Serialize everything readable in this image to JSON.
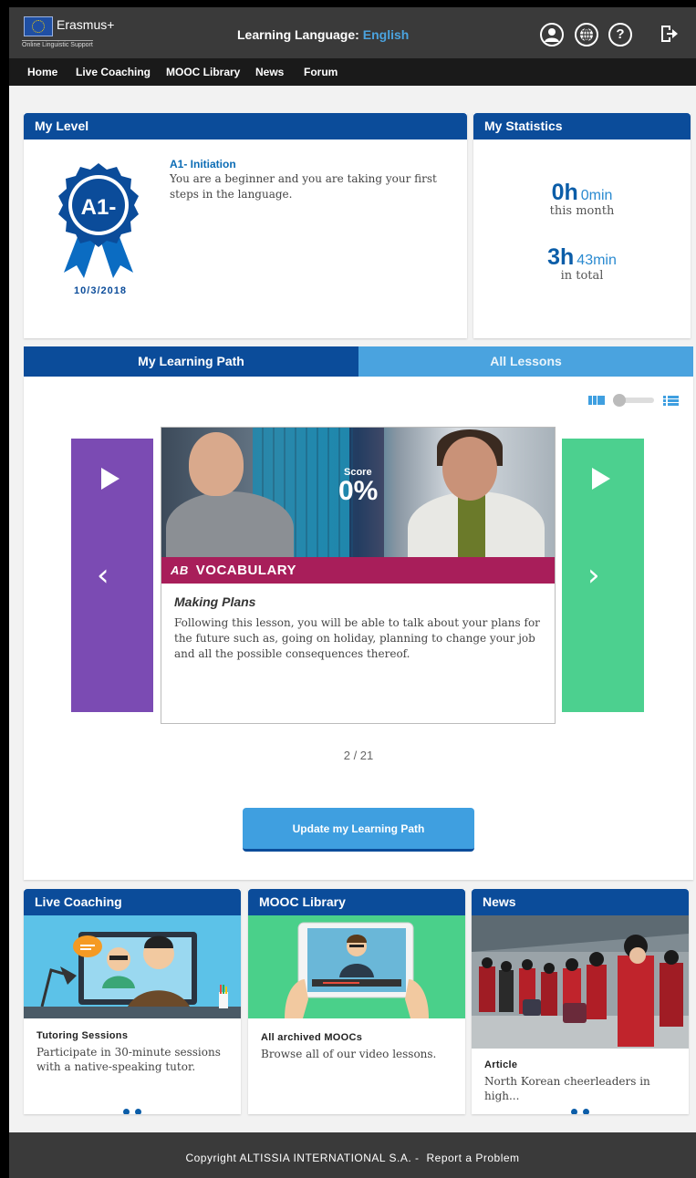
{
  "header": {
    "brand": "Erasmus+",
    "brand_sub": "Online Linguistic Support",
    "learning_language_label": "Learning Language:",
    "learning_language_value": "English",
    "icons": [
      "user-icon",
      "globe-icon",
      "help-icon",
      "logout-icon"
    ]
  },
  "nav": [
    "Home",
    "Live Coaching",
    "MOOC Library",
    "News",
    "Forum"
  ],
  "my_level": {
    "title": "My Level",
    "badge_text": "A1-",
    "date": "10/3/2018",
    "level_name": "A1- Initiation",
    "level_desc": "You are a beginner and you are taking your first steps in the language."
  },
  "my_statistics": {
    "title": "My Statistics",
    "month_hours": "0h",
    "month_minutes": "0min",
    "month_label": "this month",
    "total_hours": "3h",
    "total_minutes": "43min",
    "total_label": "in total"
  },
  "tabs": {
    "learning_path": "My Learning Path",
    "all_lessons": "All Lessons"
  },
  "lesson": {
    "score_label": "Score",
    "score_value": "0%",
    "category": "VOCABULARY",
    "category_icon": "AB",
    "title": "Making Plans",
    "description": "Following this lesson, you will be able to talk about your plans for the future such as, going on holiday, planning to change your job and all the possible consequences thereof."
  },
  "pager": "2 / 21",
  "update_button": "Update my Learning Path",
  "live_coaching": {
    "title": "Live Coaching",
    "item_title": "Tutoring Sessions",
    "item_desc": "Participate in 30-minute sessions with a native-speaking tutor."
  },
  "mooc_library": {
    "title": "MOOC Library",
    "item_title": "All archived MOOCs",
    "item_desc": "Browse all of our video lessons."
  },
  "news": {
    "title": "News",
    "item_title": "Article",
    "item_desc": "North Korean cheerleaders in high..."
  },
  "footer": {
    "copyright": "Copyright ALTISSIA INTERNATIONAL S.A. -",
    "report": "Report a Problem"
  },
  "colors": {
    "brand_blue": "#0b4c9a",
    "accent_blue": "#4aa3df",
    "vocab_magenta": "#a81e5a",
    "prev_purple": "#7b4bb3",
    "next_green": "#4cd08f"
  }
}
